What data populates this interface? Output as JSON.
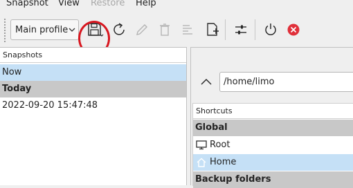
{
  "menu": {
    "snapshot": "Snapshot",
    "view": "View",
    "restore": "Restore",
    "help": "Help"
  },
  "toolbar": {
    "profile": "Main profile",
    "buttons": [
      {
        "icon": "save-icon",
        "enabled": true
      },
      {
        "icon": "refresh-icon",
        "enabled": true
      },
      {
        "icon": "edit-icon",
        "enabled": false
      },
      {
        "icon": "trash-icon",
        "enabled": false
      },
      {
        "icon": "log-icon",
        "enabled": false
      },
      {
        "icon": "add-page-icon",
        "enabled": true
      },
      {
        "icon": "settings-sliders-icon",
        "enabled": true
      },
      {
        "icon": "power-icon",
        "enabled": true
      },
      {
        "icon": "close-circle-icon",
        "enabled": true
      }
    ],
    "annotation_color": "#d8161f"
  },
  "snapshots": {
    "header": "Snapshots",
    "now": "Now",
    "group_today": "Today",
    "items": [
      "2022-09-20 15:47:48"
    ]
  },
  "browser": {
    "path": "/home/limo",
    "shortcuts_header": "Shortcuts",
    "group_global": "Global",
    "root": "Root",
    "home": "Home",
    "group_backup": "Backup folders"
  },
  "colors": {
    "selection": "#c5e0f6",
    "group_bg": "#c8c8c8",
    "accent_red": "#e0303a"
  }
}
